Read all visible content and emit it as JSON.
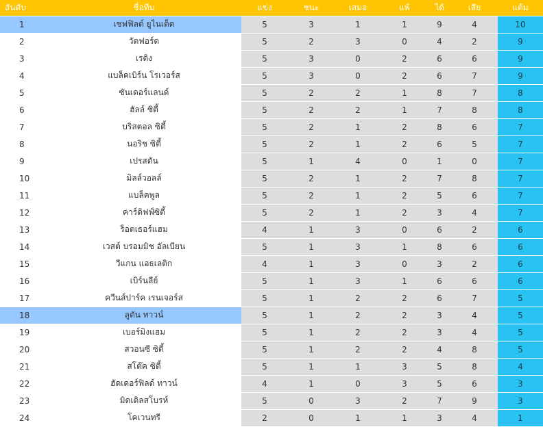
{
  "headers": {
    "rank": "อันดับ",
    "team": "ชื่อทีม",
    "played": "แข่ง",
    "won": "ชนะ",
    "drawn": "เสมอ",
    "lost": "แพ้",
    "gf": "ได้",
    "ga": "เสีย",
    "points": "แต้ม"
  },
  "colors": {
    "header_bg": "#ffc400",
    "stat_bg": "#dddddd",
    "points_bg": "#28c3f2",
    "highlight_bg": "#96c8ff"
  },
  "rows": [
    {
      "rank": "1",
      "team": "เชฟฟิลด์ ยูไนเต็ด",
      "played": "5",
      "won": "3",
      "drawn": "1",
      "lost": "1",
      "gf": "9",
      "ga": "4",
      "points": "10",
      "highlighted": true
    },
    {
      "rank": "2",
      "team": "วัตฟอร์ด",
      "played": "5",
      "won": "2",
      "drawn": "3",
      "lost": "0",
      "gf": "4",
      "ga": "2",
      "points": "9",
      "highlighted": false
    },
    {
      "rank": "3",
      "team": "เรดิง",
      "played": "5",
      "won": "3",
      "drawn": "0",
      "lost": "2",
      "gf": "6",
      "ga": "6",
      "points": "9",
      "highlighted": false
    },
    {
      "rank": "4",
      "team": "แบล็คเบิร์น โรเวอร์ส",
      "played": "5",
      "won": "3",
      "drawn": "0",
      "lost": "2",
      "gf": "6",
      "ga": "7",
      "points": "9",
      "highlighted": false
    },
    {
      "rank": "5",
      "team": "ซันเดอร์แลนด์",
      "played": "5",
      "won": "2",
      "drawn": "2",
      "lost": "1",
      "gf": "8",
      "ga": "7",
      "points": "8",
      "highlighted": false
    },
    {
      "rank": "6",
      "team": "ฮัลล์ ซิตี้",
      "played": "5",
      "won": "2",
      "drawn": "2",
      "lost": "1",
      "gf": "7",
      "ga": "8",
      "points": "8",
      "highlighted": false
    },
    {
      "rank": "7",
      "team": "บริสตอล ซิตี้",
      "played": "5",
      "won": "2",
      "drawn": "1",
      "lost": "2",
      "gf": "8",
      "ga": "6",
      "points": "7",
      "highlighted": false
    },
    {
      "rank": "8",
      "team": "นอริช ซิตี้",
      "played": "5",
      "won": "2",
      "drawn": "1",
      "lost": "2",
      "gf": "6",
      "ga": "5",
      "points": "7",
      "highlighted": false
    },
    {
      "rank": "9",
      "team": "เปรสตัน",
      "played": "5",
      "won": "1",
      "drawn": "4",
      "lost": "0",
      "gf": "1",
      "ga": "0",
      "points": "7",
      "highlighted": false
    },
    {
      "rank": "10",
      "team": "มิลล์วอลล์",
      "played": "5",
      "won": "2",
      "drawn": "1",
      "lost": "2",
      "gf": "7",
      "ga": "8",
      "points": "7",
      "highlighted": false
    },
    {
      "rank": "11",
      "team": "แบล็คพูล",
      "played": "5",
      "won": "2",
      "drawn": "1",
      "lost": "2",
      "gf": "5",
      "ga": "6",
      "points": "7",
      "highlighted": false
    },
    {
      "rank": "12",
      "team": "คาร์ดิฟฟ์ซิตี้",
      "played": "5",
      "won": "2",
      "drawn": "1",
      "lost": "2",
      "gf": "3",
      "ga": "4",
      "points": "7",
      "highlighted": false
    },
    {
      "rank": "13",
      "team": "ร็อตเธอร์แฮม",
      "played": "4",
      "won": "1",
      "drawn": "3",
      "lost": "0",
      "gf": "6",
      "ga": "2",
      "points": "6",
      "highlighted": false
    },
    {
      "rank": "14",
      "team": "เวสต์ บรอมมิช อัลเบียน",
      "played": "5",
      "won": "1",
      "drawn": "3",
      "lost": "1",
      "gf": "8",
      "ga": "6",
      "points": "6",
      "highlighted": false
    },
    {
      "rank": "15",
      "team": "วีแกน แอธเลติก",
      "played": "4",
      "won": "1",
      "drawn": "3",
      "lost": "0",
      "gf": "3",
      "ga": "2",
      "points": "6",
      "highlighted": false
    },
    {
      "rank": "16",
      "team": "เบิร์นลีย์",
      "played": "5",
      "won": "1",
      "drawn": "3",
      "lost": "1",
      "gf": "6",
      "ga": "6",
      "points": "6",
      "highlighted": false
    },
    {
      "rank": "17",
      "team": "ควีนส์ปาร์ค เรนเจอร์ส",
      "played": "5",
      "won": "1",
      "drawn": "2",
      "lost": "2",
      "gf": "6",
      "ga": "7",
      "points": "5",
      "highlighted": false
    },
    {
      "rank": "18",
      "team": "ลูตัน ทาวน์",
      "played": "5",
      "won": "1",
      "drawn": "2",
      "lost": "2",
      "gf": "3",
      "ga": "4",
      "points": "5",
      "highlighted": true
    },
    {
      "rank": "19",
      "team": "เบอร์มิงแฮม",
      "played": "5",
      "won": "1",
      "drawn": "2",
      "lost": "2",
      "gf": "3",
      "ga": "4",
      "points": "5",
      "highlighted": false
    },
    {
      "rank": "20",
      "team": "สวอนซี ซิตี้",
      "played": "5",
      "won": "1",
      "drawn": "2",
      "lost": "2",
      "gf": "4",
      "ga": "8",
      "points": "5",
      "highlighted": false
    },
    {
      "rank": "21",
      "team": "สโต๊ค ซิตี้",
      "played": "5",
      "won": "1",
      "drawn": "1",
      "lost": "3",
      "gf": "5",
      "ga": "8",
      "points": "4",
      "highlighted": false
    },
    {
      "rank": "22",
      "team": "ฮัดเดอร์ฟิลด์ ทาวน์",
      "played": "4",
      "won": "1",
      "drawn": "0",
      "lost": "3",
      "gf": "5",
      "ga": "6",
      "points": "3",
      "highlighted": false
    },
    {
      "rank": "23",
      "team": "มิดเดิลสโบรห์",
      "played": "5",
      "won": "0",
      "drawn": "3",
      "lost": "2",
      "gf": "7",
      "ga": "9",
      "points": "3",
      "highlighted": false
    },
    {
      "rank": "24",
      "team": "โคเวนทรี",
      "played": "2",
      "won": "0",
      "drawn": "1",
      "lost": "1",
      "gf": "3",
      "ga": "4",
      "points": "1",
      "highlighted": false
    }
  ]
}
